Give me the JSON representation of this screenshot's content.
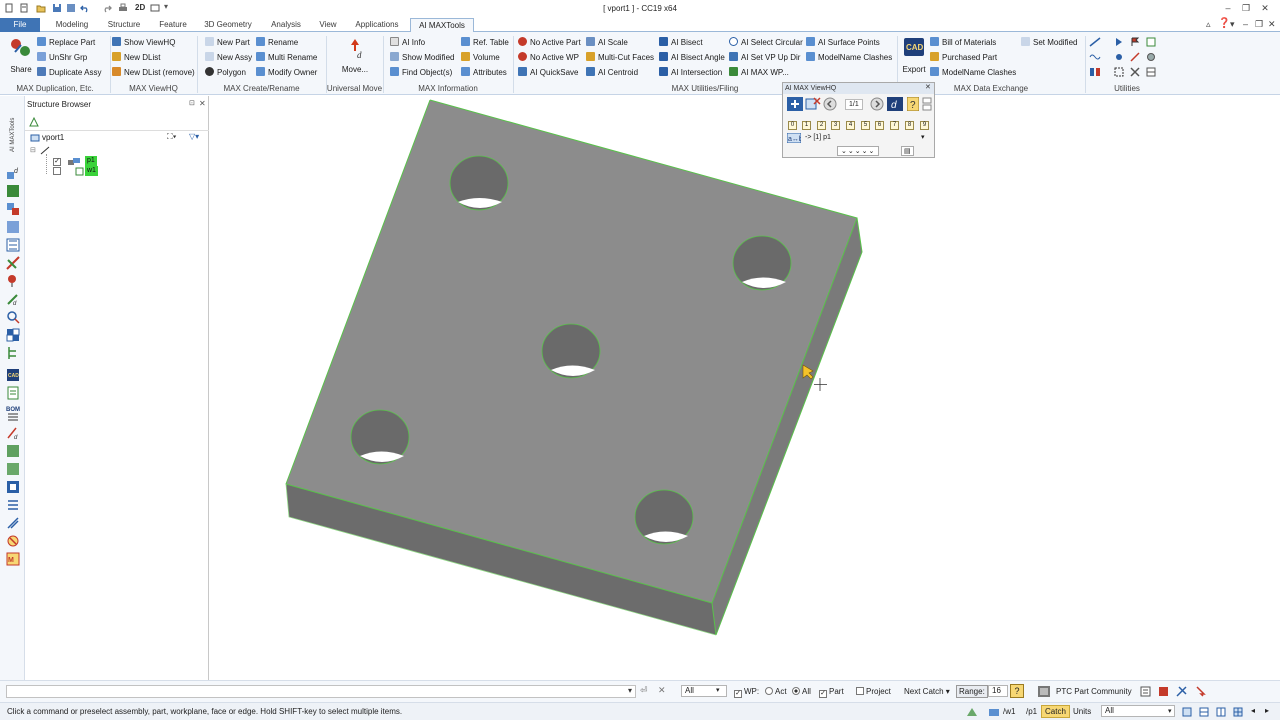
{
  "window": {
    "title": "[ vport1 ] - CC19 x64",
    "quick_zoom_label": "2D"
  },
  "tabs": [
    {
      "label": "File"
    },
    {
      "label": "Modeling"
    },
    {
      "label": "Structure"
    },
    {
      "label": "Feature"
    },
    {
      "label": "3D Geometry"
    },
    {
      "label": "Analysis"
    },
    {
      "label": "View"
    },
    {
      "label": "Applications"
    },
    {
      "label": "AI MAXTools"
    }
  ],
  "ribbon": {
    "share": {
      "label": "Share"
    },
    "duplication": {
      "items": [
        "Replace Part",
        "UnShr  Grp",
        "Duplicate Assy"
      ],
      "group_label": "MAX Duplication, Etc."
    },
    "viewhq": {
      "items": [
        "Show ViewHQ",
        "New DList",
        "New DList (remove)"
      ],
      "group_label": "MAX ViewHQ"
    },
    "create": {
      "col1": [
        "New Part",
        "New Assy",
        "Polygon"
      ],
      "col2": [
        "Rename",
        "Multi Rename",
        "Modify Owner"
      ],
      "group_label": "MAX Create/Rename"
    },
    "move": {
      "label": "Move...",
      "group_label": "Universal Move"
    },
    "information": {
      "col1": [
        "AI Info",
        "Show Modified",
        "Find Object(s)"
      ],
      "col2": [
        "Ref. Table",
        "Volume",
        "Attributes"
      ],
      "group_label": "MAX Information"
    },
    "utilities": {
      "col1": [
        "No Active Part",
        "No Active WP",
        "AI QuickSave"
      ],
      "col2": [
        "AI Scale",
        "Multi-Cut Faces",
        "AI Centroid"
      ],
      "col3": [
        "AI Bisect",
        "AI Bisect Angle",
        "AI Intersection"
      ],
      "col4": [
        "AI Select Circular",
        "AI Set VP Up Dir",
        "AI MAX WP..."
      ],
      "col5": [
        "AI Surface Points",
        "ModelName Clashes"
      ],
      "group_label": "MAX Utilities/Filing"
    },
    "exchange": {
      "export_label": "Export",
      "items": [
        "Bill of Materials",
        "Purchased Part",
        "ModelName Clashes"
      ],
      "set_modified": "Set Modified",
      "group_label": "MAX Data Exchange"
    },
    "utilities_group_label": "Utilities"
  },
  "browser": {
    "title": "Structure Browser",
    "root": "vport1",
    "part": "p1",
    "workplane": "w1"
  },
  "viewhq_panel": {
    "title": "AI MAX ViewHQ",
    "page": "1/1",
    "numbers": [
      "0",
      "1",
      "2",
      "3",
      "4",
      "5",
      "6",
      "7",
      "8",
      "9"
    ],
    "current": "-> [1] p1"
  },
  "cmdbar": {
    "filter_value": "All",
    "wp_label": "WP:",
    "act_label": "Act",
    "all_label": "All",
    "part_label": "Part",
    "project_label": "Project",
    "next_catch_label": "Next Catch",
    "range_label": "Range:",
    "range_value": "16",
    "community_label": "PTC Part Community"
  },
  "status": {
    "message": "Click a command or preselect assembly, part, workplane, face or edge. Hold SHIFT-key to select multiple items.",
    "wp_path": "/w1",
    "part_path": "/p1",
    "catch_label": "Catch",
    "units_label": "Units",
    "units_value": "All"
  },
  "colors": {
    "accent": "#3f74b5",
    "ribbon_bg": "#f4f7fb",
    "part_face": "#8c8c8c",
    "edge_highlight": "#59c24a",
    "catch_bg": "#f7d774"
  }
}
